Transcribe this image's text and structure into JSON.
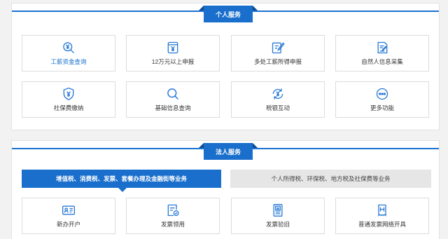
{
  "personal": {
    "title": "个人服务",
    "items": [
      {
        "label": "工薪资金查询",
        "icon": "yuan-search-icon"
      },
      {
        "label": "12万元以上申报",
        "icon": "yuan-document-icon"
      },
      {
        "label": "多处工薪所得申报",
        "icon": "edit-document-icon"
      },
      {
        "label": "自然人信息采集",
        "icon": "form-edit-icon"
      },
      {
        "label": "社保费缴纳",
        "icon": "yuan-shield-icon"
      },
      {
        "label": "基础信息查询",
        "icon": "search-icon"
      },
      {
        "label": "税银互动",
        "icon": "yuan-exchange-icon"
      },
      {
        "label": "更多功能",
        "icon": "more-icon"
      }
    ]
  },
  "corporate": {
    "title": "法人服务",
    "tabs": [
      "增值税、消费税、发票、套餐办理及金融街等业务",
      "个人所得税、环保税、地方税及社保费等业务"
    ],
    "items": [
      {
        "label": "新办开户",
        "icon": "id-card-icon"
      },
      {
        "label": "发票领用",
        "icon": "invoice-receive-icon"
      },
      {
        "label": "发票验旧",
        "icon": "invoice-verify-icon"
      },
      {
        "label": "普通发票网络开具",
        "icon": "invoice-issue-icon"
      }
    ]
  },
  "colors": {
    "accent": "#1a6fcc",
    "icon": "#2b7bd6"
  }
}
